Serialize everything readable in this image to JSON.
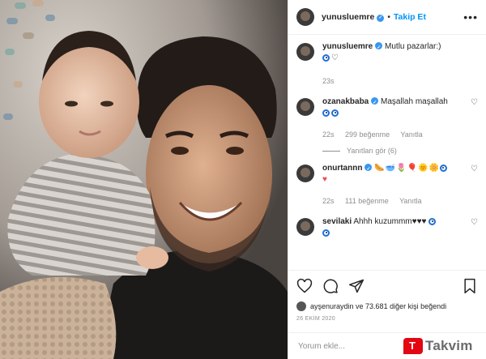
{
  "header": {
    "username": "yunusluemre",
    "follow_label": "Takip Et",
    "separator": "•",
    "more_label": "•••"
  },
  "caption": {
    "username": "yunusluemre",
    "text": "Mutlu pazarlar:)",
    "time": "23s"
  },
  "comments": [
    {
      "username": "ozanakbaba",
      "text": "Maşallah maşallah",
      "time": "22s",
      "likes": "299 beğenme",
      "reply": "Yanıtla"
    },
    {
      "username": "onurtannn",
      "time": "22s",
      "likes": "111 beğenme",
      "reply": "Yanıtla"
    },
    {
      "username": "sevilaki",
      "text": "Ahhh kuzummm♥♥♥"
    }
  ],
  "view_replies": "Yanıtları gör (6)",
  "likes_line": "ayşenuraydin ve 73.681 diğer kişi beğendi",
  "post_time": "26 EKİM 2020",
  "add_comment": {
    "placeholder": "Yorum ekle..."
  },
  "watermark": {
    "text": "Takvim",
    "brand_color": "#e30613"
  },
  "colors": {
    "link": "#0095f6",
    "verified": "#3897f0",
    "muted": "#8e8e8e"
  }
}
